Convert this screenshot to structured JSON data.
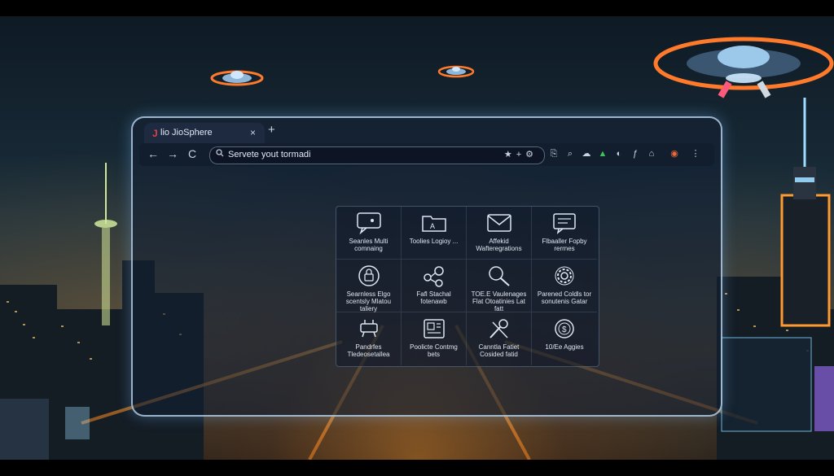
{
  "browser": {
    "tab": {
      "logo": "J",
      "title": "lio JioSphere"
    },
    "close_symbol": "×",
    "new_tab_symbol": "+",
    "nav": {
      "back": "←",
      "forward": "→",
      "reload": "C"
    },
    "omnibox": {
      "value": "Servete yout tormadi",
      "actions": "★+⚙"
    },
    "extensions": [
      "⎘",
      "⌕",
      "☁",
      "▲",
      "◐",
      "ƒ",
      "⌂",
      "◉",
      "⋮"
    ]
  },
  "grid": {
    "cells": [
      {
        "icon": "chat-icon",
        "text": "Seanles Multi comnaing"
      },
      {
        "icon": "folder-icon",
        "text": "Toolies Logioy ..."
      },
      {
        "icon": "mail-icon",
        "text": "Affekid Wafteregrations"
      },
      {
        "icon": "message-icon",
        "text": "Flbaaller Fopby rerrnes"
      },
      {
        "icon": "lock-icon",
        "text": "Searnless Elgo scentsly Mlatou taliery"
      },
      {
        "icon": "network-icon",
        "text": "Fafl Stachal fotenawb"
      },
      {
        "icon": "search-icon",
        "text": "TOE.E Vaulenages Flat Otoatinies Lat fatt"
      },
      {
        "icon": "gear-icon",
        "text": "Parened Coldls tor sonutenis Gatar"
      },
      {
        "icon": "plug-icon",
        "text": "Pandrfes Tledeosetallea"
      },
      {
        "icon": "document-icon",
        "text": "Poolicte Contmg bets"
      },
      {
        "icon": "tools-icon",
        "text": "Canntla Fatiet Cosided fatid"
      },
      {
        "icon": "coin-icon",
        "text": "10/Ee Aggies"
      }
    ]
  },
  "colors": {
    "window_border": "#c8e6ff",
    "accent_red": "#e0404a",
    "ufo_orange": "#ff7a2a"
  }
}
